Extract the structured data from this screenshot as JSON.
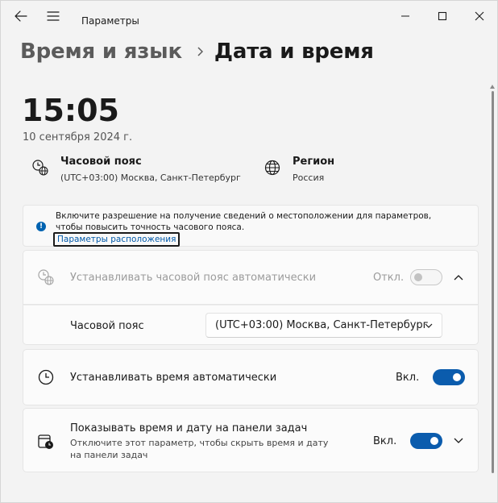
{
  "window": {
    "app_title": "Параметры"
  },
  "breadcrumb": {
    "parent": "Время и язык",
    "current": "Дата и время"
  },
  "clock": {
    "time": "15:05",
    "date": "10 сентября 2024 г."
  },
  "timezone_info": {
    "title": "Часовой пояс",
    "value": "(UTC+03:00) Москва, Санкт-Петербург"
  },
  "region_info": {
    "title": "Регион",
    "value": "Россия"
  },
  "notice": {
    "text": "Включите разрешение на получение сведений о местоположении для параметров, чтобы повысить точность часового пояса.",
    "link": "Параметры расположения",
    "icon_glyph": "!"
  },
  "settings": {
    "auto_timezone": {
      "label": "Устанавливать часовой пояс автоматически",
      "state": "Откл.",
      "enabled": false,
      "disabled": true,
      "expanded": true
    },
    "timezone_select": {
      "label": "Часовой пояс",
      "value": "(UTC+03:00) Москва, Санкт-Петербург"
    },
    "auto_time": {
      "label": "Устанавливать время автоматически",
      "state": "Вкл.",
      "enabled": true
    },
    "taskbar_time": {
      "label": "Показывать время и дату на панели задач",
      "description": "Отключите этот параметр, чтобы скрыть время и дату на панели задач",
      "state": "Вкл.",
      "enabled": true,
      "expanded": false
    }
  },
  "colors": {
    "accent": "#0b5cad",
    "background": "#f3f3f3",
    "card": "#fbfbfb"
  }
}
